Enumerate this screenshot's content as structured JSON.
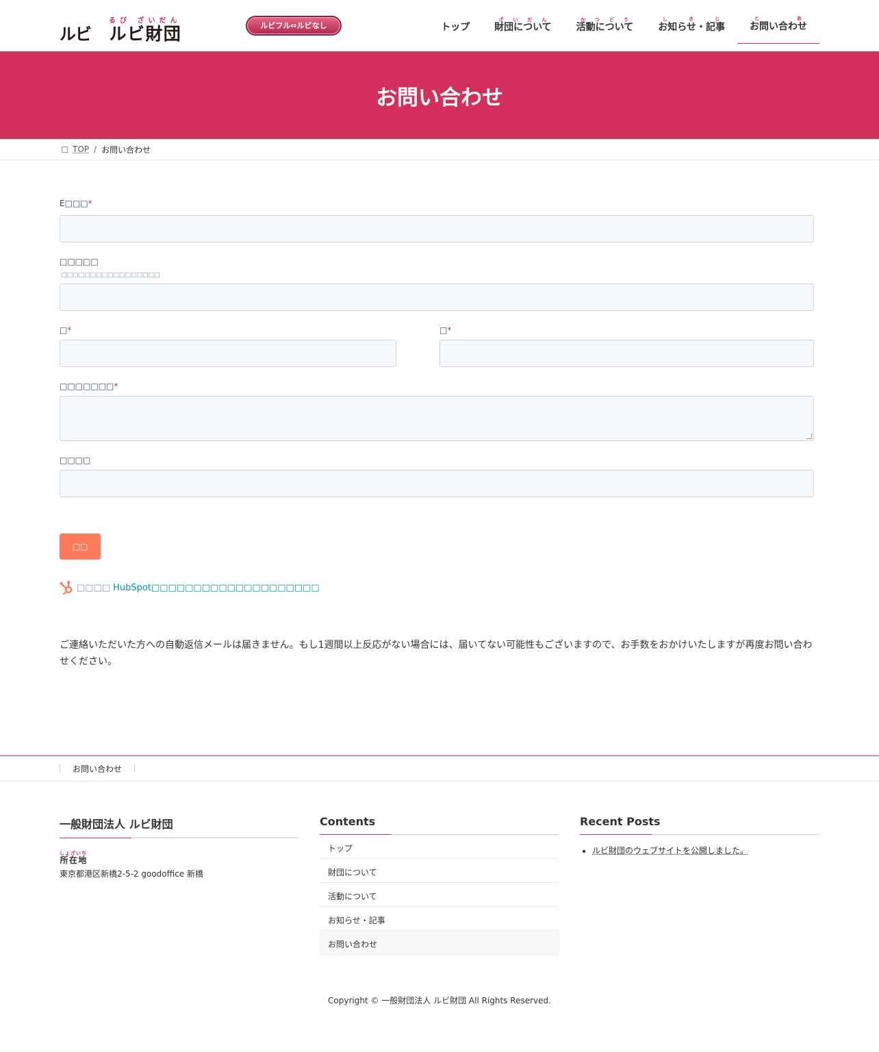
{
  "header": {
    "logo_mark": "ルビ",
    "logo_text": "ルビ財団",
    "logo_ruby": "るび ざいだん",
    "ruby_toggle": "ルビフル⇔ルビなし",
    "nav": [
      {
        "label": "トップ",
        "ruby": ""
      },
      {
        "label": "財団について",
        "ruby": "ざいだん"
      },
      {
        "label": "活動について",
        "ruby": "かつどう"
      },
      {
        "label": "お知らせ・記事",
        "ruby": "し き じ"
      },
      {
        "label": "お問い合わせ",
        "ruby": "と あ"
      }
    ]
  },
  "title": "お問い合わせ",
  "breadcrumb": {
    "home": "TOP",
    "current": "お問い合わせ"
  },
  "form": {
    "email_label": "E□□□",
    "required_mark": "*",
    "company_label": "□□□□□",
    "company_hint": "□□□□□□□□□□□□□□□□□",
    "last_name_label": "□",
    "first_name_label": "□",
    "message_label": "□□□□□□□",
    "other_label": "□□□□",
    "submit_label": "□□",
    "hs_prefix": "□□□□",
    "hs_brand": "HubSpot",
    "hs_suffix": "□□□□□□□□□□□□□□□□□□□□"
  },
  "notice": "ご連絡いただいた方への自動返信メールは届きません。もし1週間以上反応がない場合には、届いてない可能性もございますので、お手数をおかけいたしますが再度お問い合わせください。",
  "footer_nav": {
    "item": "お問い合わせ"
  },
  "widgets": {
    "org": {
      "title": "一般財団法人 ルビ財団",
      "addr_label": "所在地",
      "addr_label_ruby": "しょざいち",
      "address": "東京都港区新橋2-5-2 goodoffice 新橋"
    },
    "contents": {
      "title": "Contents",
      "items": [
        "トップ",
        "財団について",
        "活動について",
        "お知らせ・記事",
        "お問い合わせ"
      ]
    },
    "recent": {
      "title": "Recent Posts",
      "items": [
        "ルビ財団のウェブサイトを公開しました。"
      ]
    }
  },
  "copyright": "Copyright © 一般財団法人 ルビ財団 All Rights Reserved.",
  "colors": {
    "accent": "#d22f5a",
    "hubspot": "#ff7a59"
  }
}
